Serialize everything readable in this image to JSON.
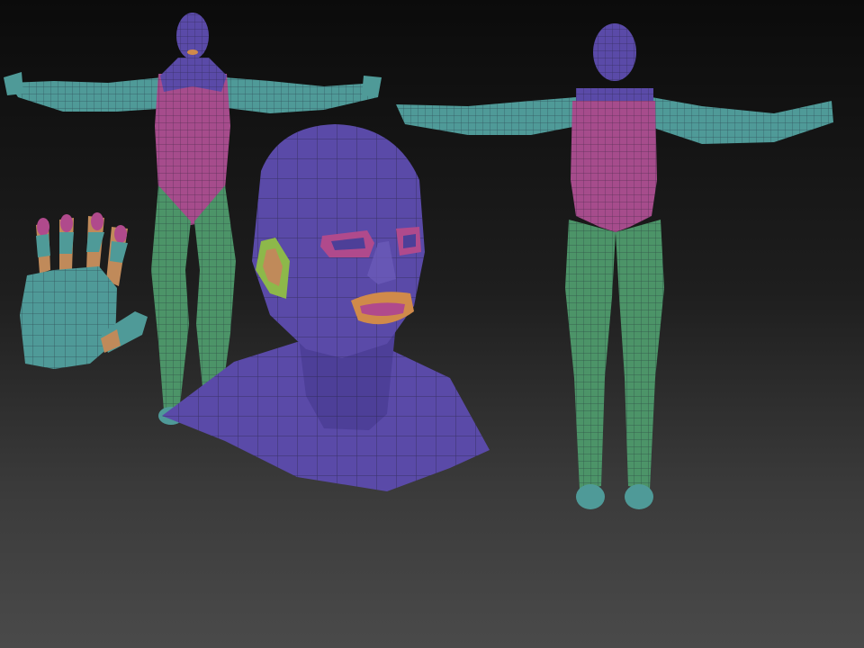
{
  "scene": {
    "objects": [
      {
        "name": "front-body"
      },
      {
        "name": "back-body"
      },
      {
        "name": "head-bust"
      },
      {
        "name": "hand"
      }
    ]
  },
  "colors": {
    "background_top": "#0b0b0b",
    "background_bottom": "#4a4a4a",
    "head": "#5a4aa8",
    "torso": "#a64c8c",
    "arms": "#4f9a98",
    "legs": "#4c9468",
    "lips": "#d08a4a",
    "ear": "#8db84a",
    "fingers": "#c08a5a",
    "nails": "#b04a8c",
    "wire": "#1a1a2a"
  }
}
